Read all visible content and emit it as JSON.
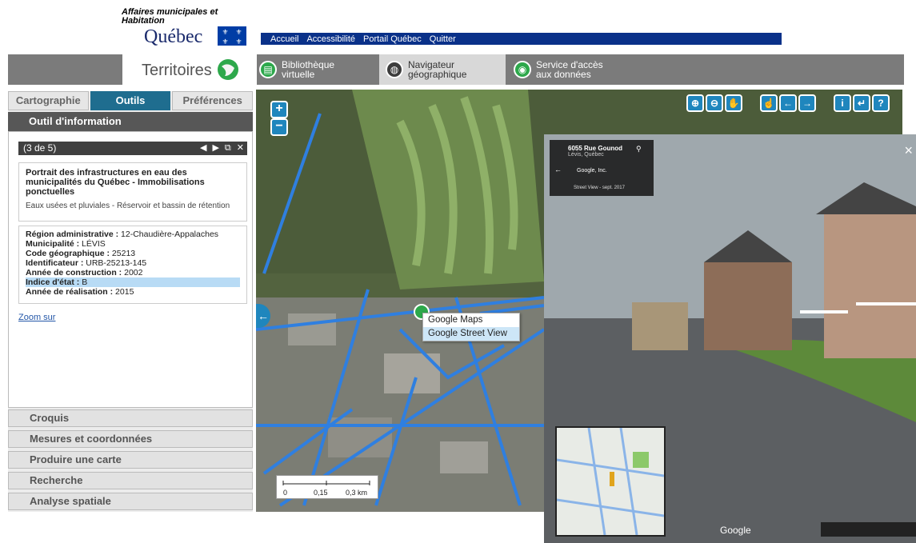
{
  "header": {
    "ministry": "Affaires municipales et Habitation",
    "quebec": "Québec",
    "nav": [
      "Accueil",
      "Accessibilité",
      "Portail Québec",
      "Quitter"
    ]
  },
  "band": {
    "brand": "Territoires",
    "buttons": [
      {
        "label1": "Bibliothèque",
        "label2": "virtuelle",
        "icon": "document-icon"
      },
      {
        "label1": "Navigateur",
        "label2": "géographique",
        "icon": "globe-icon"
      },
      {
        "label1": "Service d'accès",
        "label2": "aux données",
        "icon": "data-access-icon"
      }
    ]
  },
  "panel": {
    "tabs": [
      "Cartographie",
      "Outils",
      "Préférences"
    ],
    "tool_title": "Outil d'information",
    "pager": "(3 de 5)",
    "card_title": "Portrait des infrastructures en eau des municipalités du Québec - Immobilisations ponctuelles",
    "card_sub": "Eaux usées et pluviales - Réservoir et bassin de rétention",
    "attributes": [
      {
        "k": "Région administrative :",
        "v": "12-Chaudière-Appalaches"
      },
      {
        "k": "Municipalité :",
        "v": "LÉVIS"
      },
      {
        "k": "Code géographique :",
        "v": "25213"
      },
      {
        "k": "Identificateur :",
        "v": "URB-25213-145"
      },
      {
        "k": "Année de construction :",
        "v": "2002"
      },
      {
        "k": "Indice d'état :",
        "v": "B"
      },
      {
        "k": "Année de réalisation :",
        "v": "2015"
      }
    ],
    "zoom_link": "Zoom sur",
    "accordion": [
      "Croquis",
      "Mesures et coordonnées",
      "Produire une carte",
      "Recherche",
      "Analyse spatiale"
    ]
  },
  "map": {
    "context_menu": [
      "Google Maps",
      "Google Street View"
    ],
    "scale_labels": [
      "0",
      "0,15",
      "0,3 km"
    ],
    "zoom_in": "+",
    "zoom_out": "−"
  },
  "streetview": {
    "address": "6055 Rue Gounod",
    "city": "Lévis, Québec",
    "provider": "Google, Inc.",
    "date": "Street View - sept. 2017",
    "logo": "Google"
  }
}
